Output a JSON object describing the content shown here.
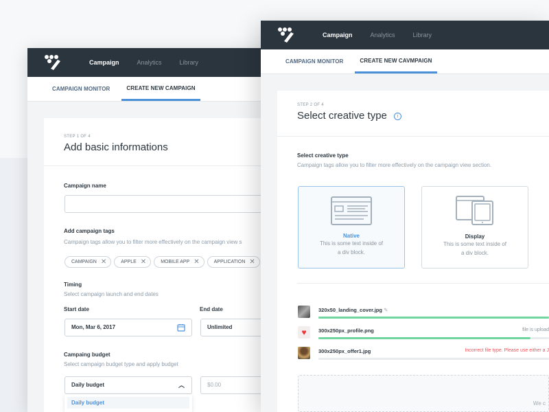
{
  "nav": {
    "items": [
      "Campaign",
      "Analytics",
      "Library"
    ]
  },
  "left": {
    "tabs": [
      "CAMPAIGN MONITOR",
      "CREATE NEW CAMPAIGN"
    ],
    "step": "STEP 1 OF 4",
    "title": "Add basic informations",
    "campaign_name": {
      "label": "Campaign name",
      "value": ""
    },
    "tags": {
      "label": "Add campaign tags",
      "help": "Campaign tags allow you to filter more effectively on the campaign view s",
      "items": [
        "CAMPAIGN",
        "APPLE",
        "MOBILE APP",
        "APPLICATION"
      ]
    },
    "timing": {
      "label": "Timing",
      "help": "Select campaign launch and end dates",
      "start_label": "Start date",
      "start_value": "Mon, Mar 6, 2017",
      "end_label": "End date",
      "end_value": "Unlimited"
    },
    "budget": {
      "label": "Campaing budget",
      "help": "Select campaign budget type and apply budget",
      "type_value": "Daily budget",
      "amount_placeholder": "$0.00",
      "options": [
        "Daily budget"
      ]
    }
  },
  "right": {
    "tabs": [
      "CAMPAIGN MONITOR",
      "CREATE NEW CAVMPAIGN"
    ],
    "step": "STEP 2 OF 4",
    "title": "Select creative type",
    "section_label": "Select creative type",
    "section_help": "Campaign tags allow you to filter more effectively on the campaign view section.",
    "types": [
      {
        "name": "Native",
        "desc1": "This is some text inside of",
        "desc2": "a div block.",
        "selected": true
      },
      {
        "name": "Display",
        "desc1": "This is some text inside of",
        "desc2": "a div block.",
        "selected": false
      }
    ],
    "files": [
      {
        "name": "320x50_landing_cover.jpg",
        "progress": 1.0,
        "status": ""
      },
      {
        "name": "300x250px_profile.png",
        "progress": 0.92,
        "status": "file is upload"
      },
      {
        "name": "300x250px_offer1.jpg",
        "progress": 0,
        "status": "Incorrect file type. Please use either a J"
      }
    ],
    "dropzone_text": "We c"
  },
  "colors": {
    "accent": "#4a90d9",
    "success": "#6fd6a0",
    "error": "#f0545c",
    "header": "#2b353e"
  }
}
